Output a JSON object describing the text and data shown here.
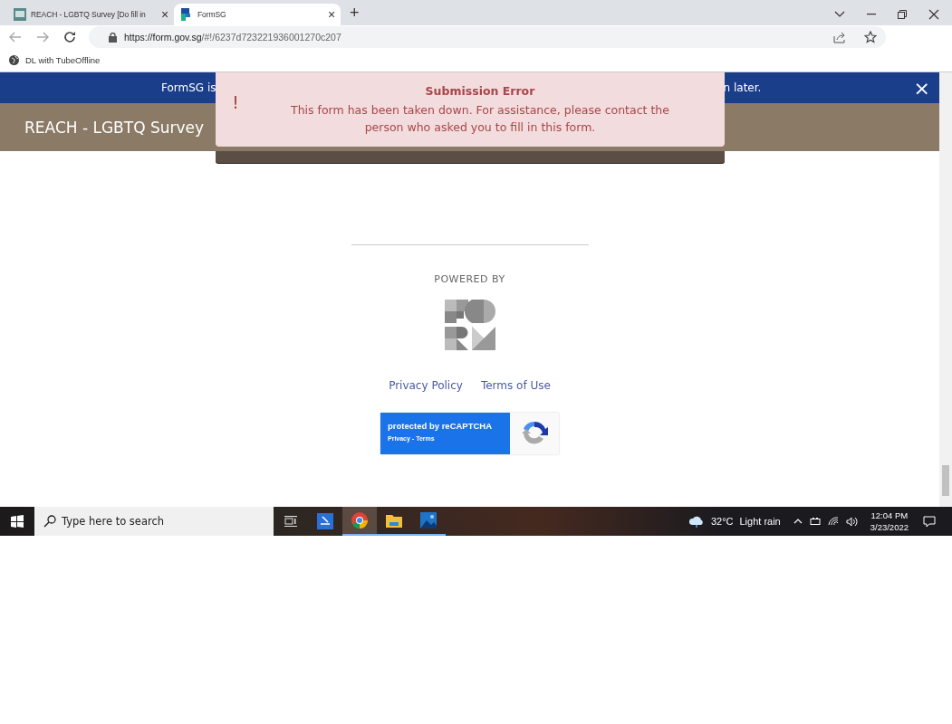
{
  "browser": {
    "tabs": [
      {
        "title": "REACH - LGBTQ Survey [Do fill in",
        "close": "×",
        "selected": false,
        "kind": "survey"
      },
      {
        "title": "FormSG",
        "close": "×",
        "selected": true,
        "kind": "formsg"
      }
    ],
    "new_tab": "+",
    "url_host": "https://form.gov.sg",
    "url_path": "/#!/6237d723221936001270c207",
    "bookmarks": [
      {
        "label": "DL with TubeOffline"
      }
    ]
  },
  "banner": {
    "text_start": "FormSG is",
    "text_end": "n later.",
    "close": "×"
  },
  "header": {
    "title": "REACH - LGBTQ Survey"
  },
  "toast": {
    "icon": "!",
    "title": "Submission Error",
    "message": "This form has been taken down. For assistance, please contact the person who asked you to fill in this form."
  },
  "footer": {
    "powered_by": "POWERED BY",
    "links": [
      "Privacy Policy",
      "Terms of Use"
    ],
    "recaptcha": {
      "title": "protected by reCAPTCHA",
      "links": "Privacy - Terms"
    }
  },
  "taskbar": {
    "search_placeholder": "Type here to search",
    "apps": [
      {
        "kind": "scanner",
        "selected": false,
        "running": false
      },
      {
        "kind": "chrome",
        "selected": true,
        "running": true
      },
      {
        "kind": "files",
        "selected": false,
        "running": true
      },
      {
        "kind": "photos",
        "selected": false,
        "running": true
      }
    ],
    "weather": {
      "temp": "32°C",
      "condition": "Light rain"
    },
    "time": "12:04 PM",
    "date": "3/23/2022"
  }
}
